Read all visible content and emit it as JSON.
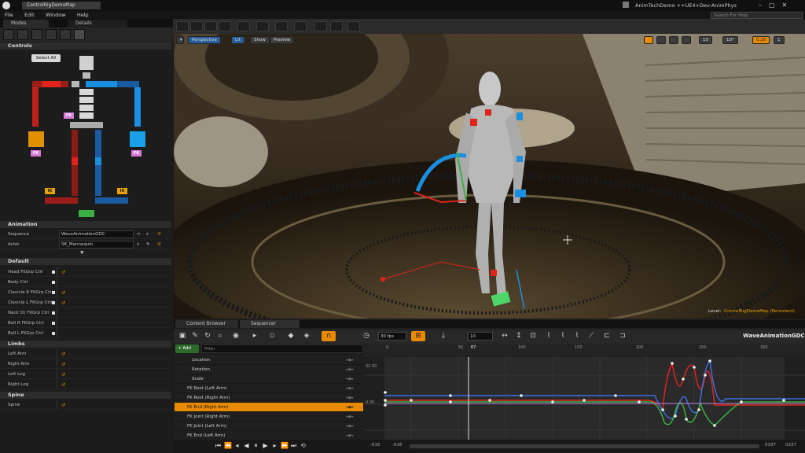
{
  "titlebar": {
    "doc_tab": "ControlRigDemoMap",
    "app_title": "AnimTechDemo ++UE4+Dev-AnimPhys"
  },
  "menu": [
    "File",
    "Edit",
    "Window",
    "Help"
  ],
  "search": {
    "placeholder": "Search For Help"
  },
  "left_tabs": {
    "modes": "Modes",
    "details": "Details"
  },
  "controls": {
    "header": "Controls",
    "select_all": "Select All",
    "fk": "FK",
    "ik": "IK"
  },
  "animation": {
    "header": "Animation",
    "sequence_label": "Sequence",
    "sequence_value": "WaveAnimationGDC",
    "actor_label": "Actor",
    "actor_value": "SK_Mannequin"
  },
  "default_section": {
    "header": "Default",
    "items": [
      "Head FKGrp Ctrl",
      "Body Ctrl",
      "Clavicle R FKGrp Ctrl",
      "Clavicle L FKGrp Ctrl",
      "Neck 01 FKGrp Ctrl",
      "Ball R FKGrp Ctrl",
      "Ball L FKGrp Ctrl"
    ]
  },
  "limbs": {
    "header": "Limbs",
    "items": [
      "Left Arm",
      "Right Arm",
      "Left Leg",
      "Right Leg"
    ]
  },
  "spine": {
    "header": "Spine",
    "items": [
      "Spine"
    ]
  },
  "viewport": {
    "perspective": "Perspective",
    "lit": "Lit",
    "show": "Show",
    "preview": "Preview",
    "grid_value": "10",
    "angle_value": "10°",
    "scale_value": "0.25",
    "cam_speed": "1",
    "level_label": "Level:",
    "level_name": "ControlRigDemoMap (Persistent)"
  },
  "sequencer": {
    "tab_content": "Content Browser",
    "tab_seq": "Sequencer",
    "fps": "30 fps",
    "snap_value": "10",
    "sequence_name": "WaveAnimationGDC",
    "add": "+ Add",
    "filter_placeholder": "Filter",
    "current_frame": "67",
    "tracks": [
      "Location",
      "Rotation",
      "Scale",
      "FK Root (Left Arm)",
      "FK Root (Right Arm)",
      "FK End (Right Arm)",
      "FK Joint (Right Arm)",
      "FK Joint (Left Arm)",
      "FK End (Left Arm)"
    ],
    "ticks": [
      "0",
      "50",
      "100",
      "150",
      "200",
      "250",
      "300"
    ],
    "y_top": "32.00",
    "y_mid": "0.00",
    "range_start": "-016",
    "range_start2": "-016",
    "range_end": "0337",
    "range_end2": "0337"
  },
  "colors": {
    "accent": "#e88a00",
    "fk_pink": "#d77ad8",
    "ik_orange": "#e6a100",
    "ctrl_red": "#e0241b",
    "ctrl_blue": "#1a8fe0",
    "ctrl_green": "#3cb043"
  }
}
